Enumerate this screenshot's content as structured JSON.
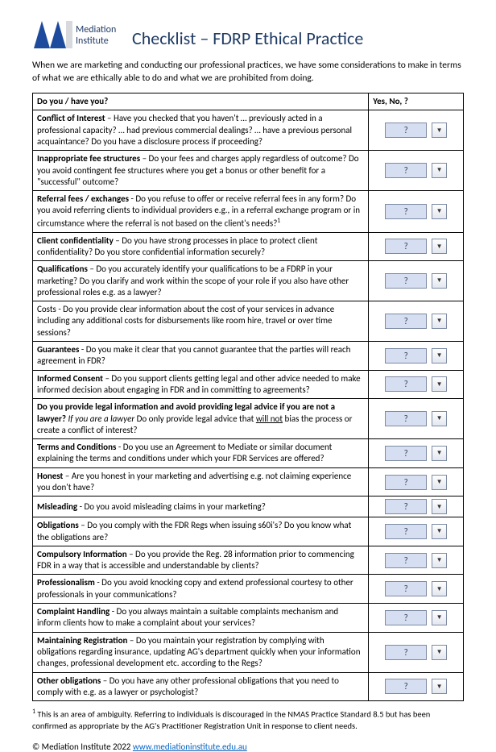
{
  "brand": {
    "name": "Mediation Institute"
  },
  "title": "Checklist – FDRP Ethical Practice",
  "intro": "When we are marketing and conducting our professional practices, we have some considerations to make in terms of what we are ethically able to do and what we are prohibited from doing.",
  "table": {
    "header_question": "Do you / have you?",
    "header_answer": "Yes, No, ?",
    "default_value": "?",
    "rows": [
      {
        "lead": "Conflict of Interest",
        "rest": " – Have you checked that you haven't … previously acted in a professional capacity? … had previous commercial dealings? … have a previous personal acquaintance? Do you have a disclosure process if proceeding?",
        "sup": ""
      },
      {
        "lead": "Inappropriate fee structures",
        "rest": " – Do your fees and charges apply regardless of outcome? Do you avoid contingent fee structures where you get a bonus or other benefit for a \"successful\" outcome?",
        "sup": ""
      },
      {
        "lead": "Referral fees / exchanges",
        "rest": " - Do you refuse to offer or receive referral fees in any form? Do you avoid referring clients to individual providers e.g., in a referral exchange program or in circumstance where the referral is not based on the client's needs?",
        "sup": "1"
      },
      {
        "lead": "Client confidentiality",
        "rest": " – Do you have strong processes in place to protect client confidentiality? Do you store confidential information securely?",
        "sup": ""
      },
      {
        "lead": "Qualifications",
        "rest": " – Do you accurately identify your qualifications to be a FDRP in your marketing? Do you clarify and work within the scope of your role if you also have other professional roles e.g. as a lawyer?",
        "sup": ""
      },
      {
        "lead": "",
        "rest": "Costs - Do you provide clear information about the cost of your services in advance including any additional costs for disbursements like room hire, travel or over time sessions?",
        "sup": ""
      },
      {
        "lead": "Guarantees",
        "rest": " - Do you make it clear that you cannot guarantee that the parties will reach agreement in FDR?",
        "sup": ""
      },
      {
        "lead": "Informed Consent",
        "rest": " – Do you support clients getting legal and other advice needed to make informed decision about engaging in FDR and in committing to agreements?",
        "sup": ""
      },
      {
        "lead": "__legal__",
        "rest": "",
        "sup": ""
      },
      {
        "lead": "Terms and Conditions",
        "rest": " - Do you use an Agreement to Mediate or similar document explaining the terms and conditions under which your FDR Services are offered?",
        "sup": ""
      },
      {
        "lead": "Honest",
        "rest": " – Are you honest in your marketing and advertising e.g. not claiming experience you don't have?",
        "sup": ""
      },
      {
        "lead": "Misleading",
        "rest": " - Do you avoid misleading claims in your marketing?",
        "sup": ""
      },
      {
        "lead": "Obligations",
        "rest": " – Do you comply with the FDR Regs when issuing s60i's? Do you know what the obligations are?",
        "sup": ""
      },
      {
        "lead": "Compulsory Information",
        "rest": " – Do you provide the Reg. 28 information prior to commencing FDR in a way that is accessible and understandable by clients?",
        "sup": ""
      },
      {
        "lead": "Professionalism",
        "rest": " - Do you avoid knocking copy and extend professional courtesy to other professionals in your communications?",
        "sup": ""
      },
      {
        "lead": "Complaint Handling",
        "rest": " - Do you always maintain a suitable complaints mechanism and inform clients how to make a complaint about your services?",
        "sup": ""
      },
      {
        "lead": "Maintaining Registration",
        "rest": " – Do you maintain your registration by complying with obligations regarding insurance, updating AG's department quickly when your information changes, professional development etc. according to the Regs?",
        "sup": ""
      },
      {
        "lead": "Other obligations",
        "rest": " – Do you have any other professional obligations that you need to comply with e.g. as a lawyer or psychologist?",
        "sup": ""
      }
    ],
    "legal_row": {
      "bold_part": "Do you provide legal information and avoid providing legal advice if you are not a lawyer?",
      "italic_part": "If you are a lawyer",
      "plain_part_1": " Do only provide legal advice that ",
      "underline_part": "will not",
      "plain_part_2": " bias the process or create a conflict of interest?"
    }
  },
  "footnote": {
    "marker": "1",
    "text": " This is an area of ambiguity. Referring to individuals is discouraged in the NMAS Practice Standard 8.5 but has been confirmed as appropriate by the AG's Practitioner Registration Unit in response to client needs."
  },
  "copyright": {
    "text": "© Mediation Institute 2022  ",
    "link_text": "www.mediationinstitute.edu.au"
  }
}
